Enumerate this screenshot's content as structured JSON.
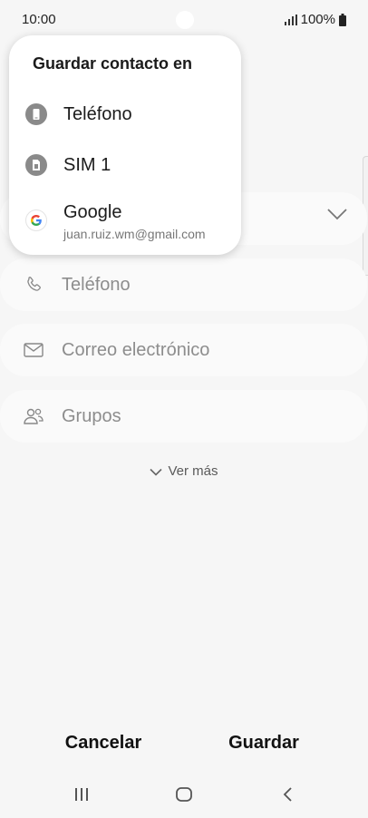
{
  "status_bar": {
    "time": "10:00",
    "battery": "100%"
  },
  "popup": {
    "title": "Guardar contacto en",
    "items": [
      {
        "label": "Teléfono",
        "icon": "phone-device-icon"
      },
      {
        "label": "SIM 1",
        "icon": "sim-card-icon"
      },
      {
        "label": "Google",
        "sublabel": "juan.ruiz.wm@gmail.com",
        "icon": "google-icon"
      }
    ]
  },
  "form": {
    "fields": [
      {
        "label": "Teléfono",
        "icon": "phone-icon"
      },
      {
        "label": "Correo electrónico",
        "icon": "email-icon"
      },
      {
        "label": "Grupos",
        "icon": "groups-icon"
      }
    ],
    "more_label": "Ver más"
  },
  "actions": {
    "cancel_label": "Cancelar",
    "save_label": "Guardar"
  },
  "colors": {
    "background": "#f6f6f6",
    "field_background": "#fafafa",
    "popup_background": "#ffffff",
    "placeholder_text": "#8d8d8d"
  }
}
